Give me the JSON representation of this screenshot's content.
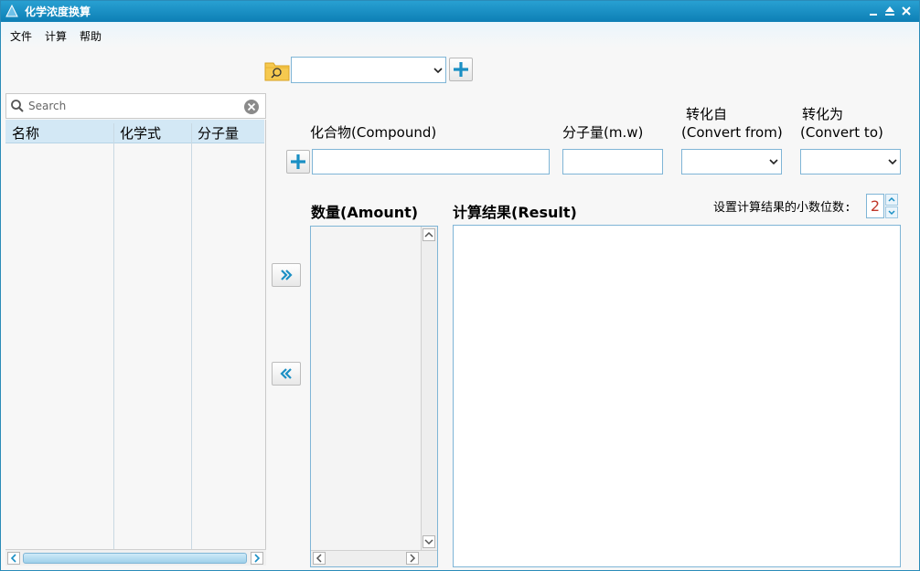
{
  "window": {
    "title": "化学浓度换算"
  },
  "menu": {
    "items": [
      "文件",
      "计算",
      "帮助"
    ]
  },
  "left": {
    "search_placeholder": "Search",
    "columns": [
      "名称",
      "化学式",
      "分子量"
    ]
  },
  "form": {
    "compound_label": "化合物(Compound)",
    "mw_label": "分子量(m.w)",
    "convert_from_label_1": "转化自",
    "convert_from_label_2": "(Convert from)",
    "convert_to_label_1": "转化为",
    "convert_to_label_2": "(Convert to)",
    "compound_value": "",
    "mw_value": ""
  },
  "amount_label": "数量(Amount)",
  "result_label": "计算结果(Result)",
  "decimal": {
    "label": "设置计算结果的小数位数:",
    "value": "2"
  },
  "colors": {
    "accent": "#1a8fc4",
    "title_bar": "#1b8fc6",
    "decimal_value": "#c0392b"
  },
  "icons": [
    "app-icon",
    "minimize-icon",
    "maximize-icon",
    "close-icon",
    "folder-search-icon",
    "plus-icon",
    "search-icon",
    "clear-icon",
    "chevron-down-icon",
    "double-chevron-right-icon",
    "double-chevron-left-icon"
  ]
}
